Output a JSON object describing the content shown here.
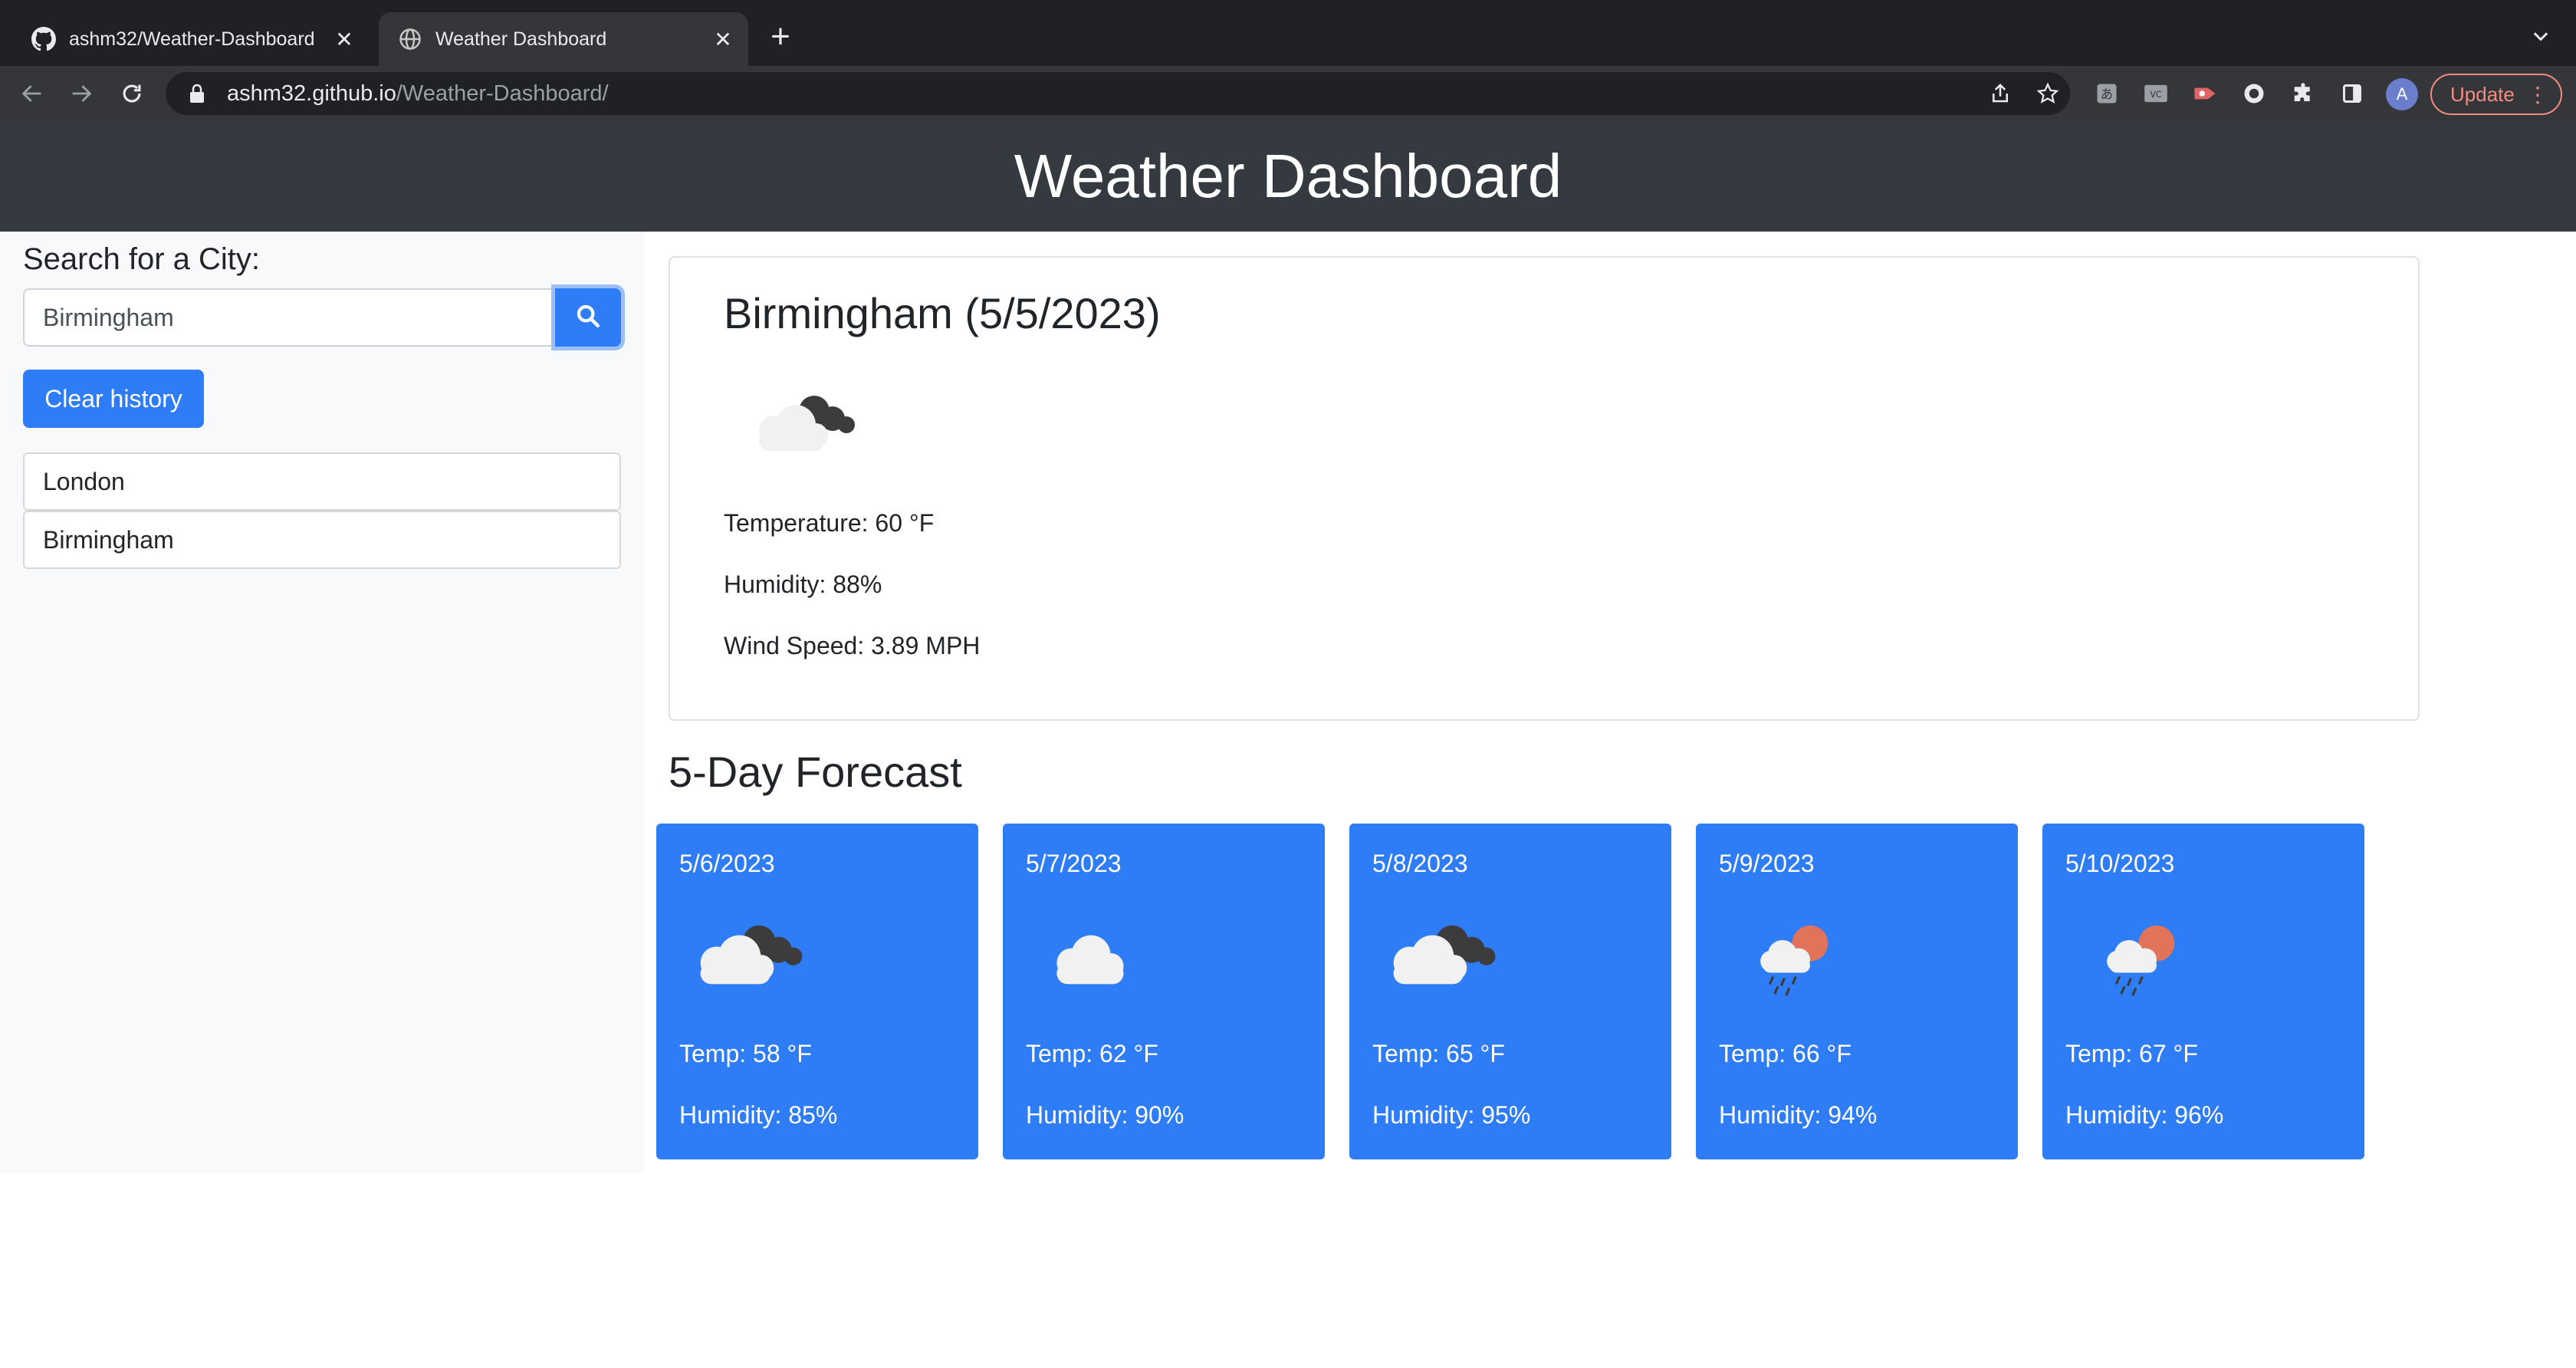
{
  "browser": {
    "tabs": [
      {
        "title": "ashm32/Weather-Dashboard",
        "active": false,
        "icon": "github-icon"
      },
      {
        "title": "Weather Dashboard",
        "active": true,
        "icon": "globe-icon"
      }
    ],
    "url_host": "ashm32.github.io",
    "url_path": "/Weather-Dashboard/",
    "avatar_letter": "A",
    "update_label": "Update"
  },
  "header": {
    "title": "Weather Dashboard"
  },
  "sidebar": {
    "label": "Search for a City:",
    "search_value": "Birmingham",
    "clear_label": "Clear history",
    "history": [
      "London",
      "Birmingham"
    ]
  },
  "current": {
    "title": "Birmingham (5/5/2023)",
    "icon": "broken-clouds-icon",
    "temperature": "Temperature: 60 °F",
    "humidity": "Humidity: 88%",
    "wind": "Wind Speed: 3.89 MPH"
  },
  "forecast": {
    "title": "5-Day Forecast",
    "days": [
      {
        "date": "5/6/2023",
        "icon": "broken-clouds-icon",
        "temp": "Temp: 58 °F",
        "humidity": "Humidity: 85%"
      },
      {
        "date": "5/7/2023",
        "icon": "cloud-icon",
        "temp": "Temp: 62 °F",
        "humidity": "Humidity: 90%"
      },
      {
        "date": "5/8/2023",
        "icon": "broken-clouds-icon",
        "temp": "Temp: 65 °F",
        "humidity": "Humidity: 95%"
      },
      {
        "date": "5/9/2023",
        "icon": "rain-sun-icon",
        "temp": "Temp: 66 °F",
        "humidity": "Humidity: 94%"
      },
      {
        "date": "5/10/2023",
        "icon": "rain-sun-icon",
        "temp": "Temp: 67 °F",
        "humidity": "Humidity: 96%"
      }
    ]
  },
  "colors": {
    "primary": "#2f7df6",
    "header_bg": "#343a40",
    "sidebar_bg": "#f8f9fa",
    "chrome_bg": "#202124"
  }
}
